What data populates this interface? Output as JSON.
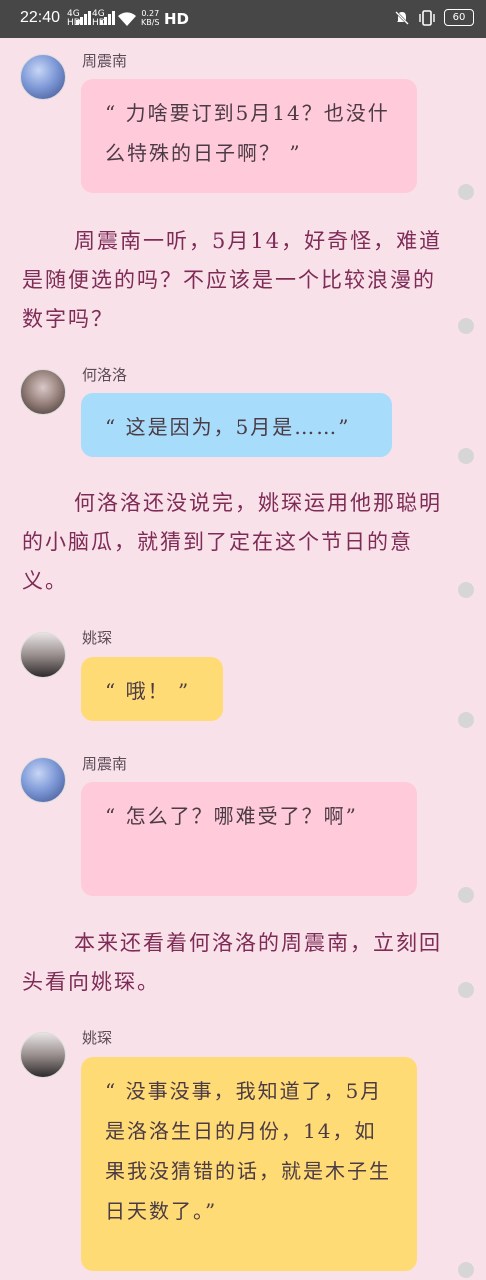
{
  "statusbar": {
    "time": "22:40",
    "sig1_top": "4G",
    "sig1_bot": "HD",
    "sig2_top": "4G",
    "sig2_bot": "HD",
    "net_speed": "0.27",
    "net_unit": "KB/S",
    "hd": "HD",
    "battery": "60"
  },
  "messages": [
    {
      "speaker": "周震南",
      "text": "“ 力啥要订到5月14？也没什么特殊的日子啊？ ”"
    },
    {
      "speaker": "何洛洛",
      "text": "“ 这是因为，5月是……”"
    },
    {
      "speaker": "姚琛",
      "text": "“ 哦！ ”"
    },
    {
      "speaker": "周震南",
      "text": "“ 怎么了？哪难受了？啊”"
    },
    {
      "speaker": "姚琛",
      "text": "“ 没事没事，我知道了，5月是洛洛生日的月份，14，如果我没猜错的话，就是木子生日天数了。”"
    }
  ],
  "paragraphs": [
    "周震南一听，5月14，好奇怪，难道是随便选的吗？不应该是一个比较浪漫的数字吗？",
    "何洛洛还没说完，姚琛运用他那聪明的小脑瓜，就猜到了定在这个节日的意义。",
    "本来还看着何洛洛的周震南，立刻回头看向姚琛。"
  ],
  "colors": {
    "background": "#f9e1ea",
    "bubble_pink": "#ffcad9",
    "bubble_blue": "#a8dcfb",
    "bubble_yellow": "#ffdb76",
    "paragraph_text": "#7e2c56"
  }
}
